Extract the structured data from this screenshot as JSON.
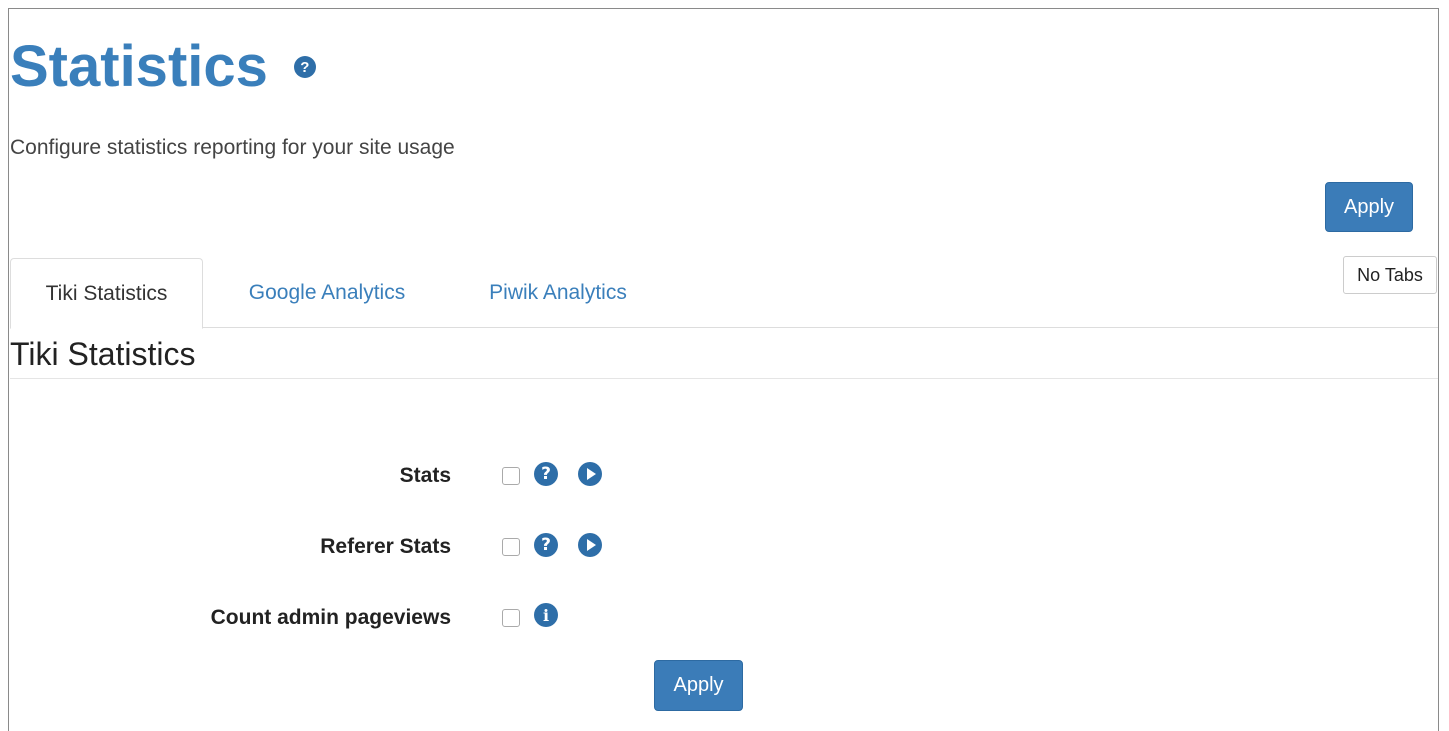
{
  "header": {
    "title": "Statistics",
    "help_icon": "question-circle-icon",
    "description": "Configure statistics reporting for your site usage"
  },
  "actions": {
    "apply_top_label": "Apply",
    "apply_bottom_label": "Apply",
    "no_tabs_label": "No Tabs"
  },
  "tabs": [
    {
      "label": "Tiki Statistics",
      "active": true
    },
    {
      "label": "Google Analytics",
      "active": false
    },
    {
      "label": "Piwik Analytics",
      "active": false
    }
  ],
  "section": {
    "title": "Tiki Statistics",
    "fields": [
      {
        "label": "Stats",
        "checked": false,
        "icons": [
          "question-circle-icon",
          "play-circle-icon"
        ]
      },
      {
        "label": "Referer Stats",
        "checked": false,
        "icons": [
          "question-circle-icon",
          "play-circle-icon"
        ]
      },
      {
        "label": "Count admin pageviews",
        "checked": false,
        "icons": [
          "info-circle-icon"
        ]
      }
    ]
  },
  "colors": {
    "accent": "#3a7fbb",
    "button": "#3b7cb8",
    "icon": "#2e6ea8"
  }
}
